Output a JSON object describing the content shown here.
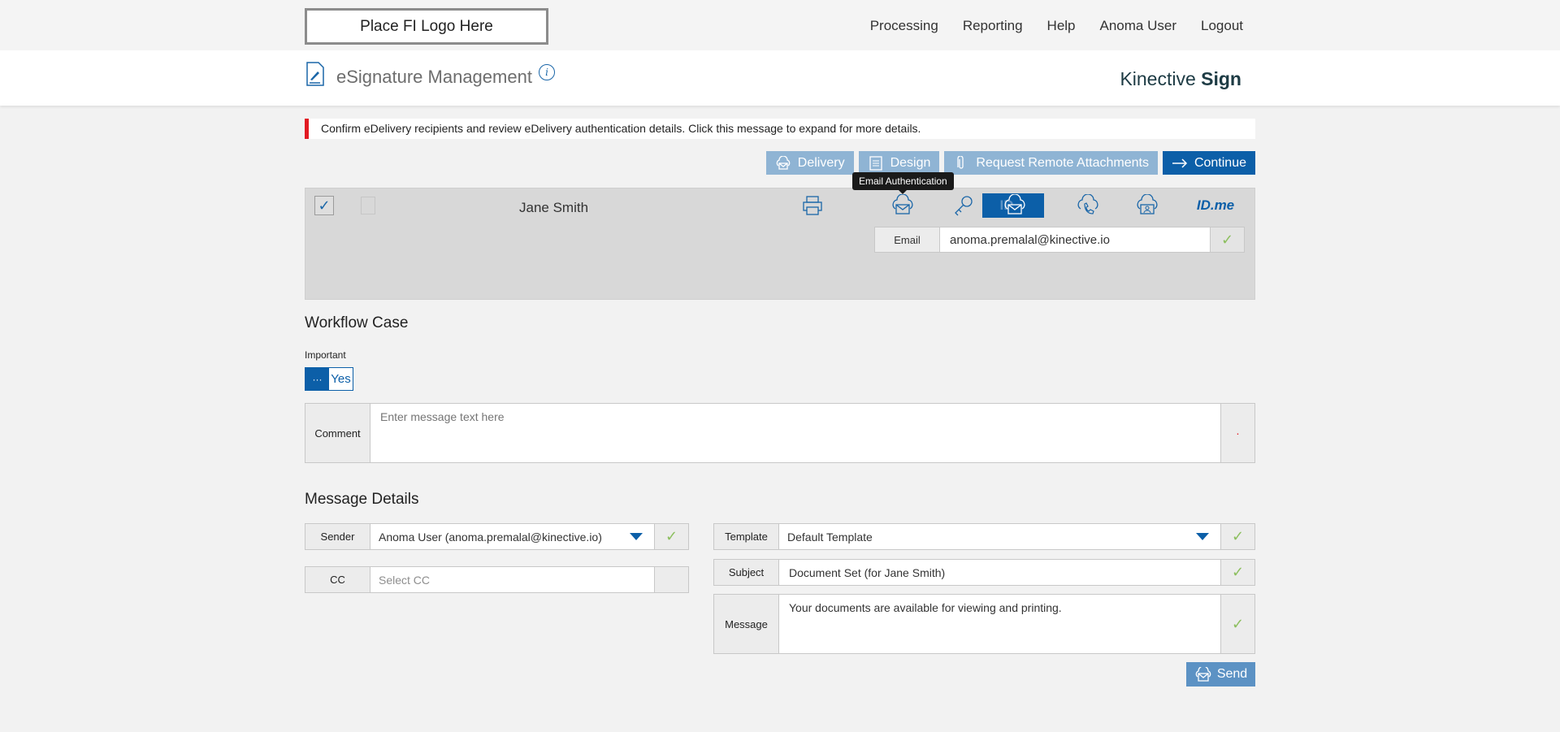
{
  "header": {
    "logo_text": "Place FI Logo Here",
    "nav": [
      "Processing",
      "Reporting",
      "Help",
      "Anoma User",
      "Logout"
    ]
  },
  "titlebar": {
    "title": "eSignature Management",
    "info_glyph": "i",
    "brand_light": "Kinective ",
    "brand_bold": "Sign"
  },
  "alert": {
    "text": "Confirm eDelivery recipients and review eDelivery authentication details. Click this message to expand for more details.",
    "accent": "#e21a23"
  },
  "actions": {
    "delivery": "Delivery",
    "design": "Design",
    "attachments": "Request Remote Attachments",
    "continue": "Continue"
  },
  "recipient": {
    "checked_glyph": "✓",
    "name": "Jane Smith",
    "tooltip": "Email Authentication",
    "idme": "ID.me",
    "idme_ghost": "ID",
    "email_label": "Email",
    "email_value": "anoma.premalal@kinective.io",
    "ok_glyph": "✓"
  },
  "workflow": {
    "heading": "Workflow Case",
    "important_label": "Important",
    "toggle_knob": "···",
    "toggle_value": "Yes",
    "comment_label": "Comment",
    "comment_placeholder": "Enter message text here",
    "comment_marker": "·"
  },
  "message": {
    "heading": "Message Details",
    "sender_label": "Sender",
    "sender_value": "Anoma User (anoma.premalal@kinective.io)",
    "cc_label": "CC",
    "cc_placeholder": "Select CC",
    "template_label": "Template",
    "template_value": "Default Template",
    "subject_label": "Subject",
    "subject_value": "Document Set (for Jane Smith)",
    "message_label": "Message",
    "message_value": "Your documents are available for viewing and printing.",
    "send": "Send",
    "ok_glyph": "✓"
  },
  "colors": {
    "primary": "#0c5fa8",
    "primary_light": "#8fb4d4",
    "check_green": "#8cbf5e"
  }
}
